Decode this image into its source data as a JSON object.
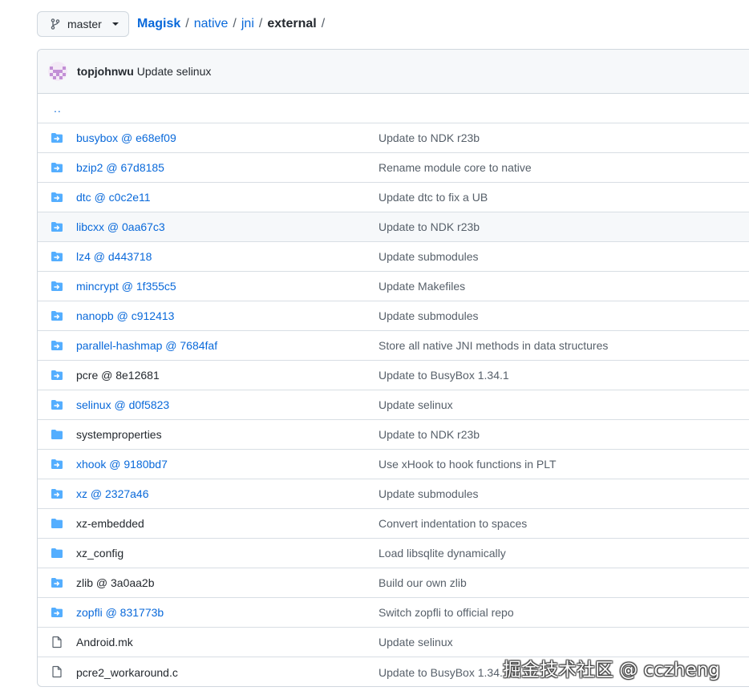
{
  "branch": {
    "label": "master"
  },
  "breadcrumb": {
    "repo": "Magisk",
    "seg1": "native",
    "seg2": "jni",
    "current": "external",
    "sep": "/"
  },
  "commit": {
    "author": "topjohnwu",
    "message": "Update selinux"
  },
  "parent_link": "..",
  "files": [
    {
      "name": "busybox @ e68ef09",
      "message": "Update to NDK r23b",
      "type": "submodule",
      "link": true
    },
    {
      "name": "bzip2 @ 67d8185",
      "message": "Rename module core to native",
      "type": "submodule",
      "link": true
    },
    {
      "name": "dtc @ c0c2e11",
      "message": "Update dtc to fix a UB",
      "type": "submodule",
      "link": true
    },
    {
      "name": "libcxx @ 0aa67c3",
      "message": "Update to NDK r23b",
      "type": "submodule",
      "link": true
    },
    {
      "name": "lz4 @ d443718",
      "message": "Update submodules",
      "type": "submodule",
      "link": true
    },
    {
      "name": "mincrypt @ 1f355c5",
      "message": "Update Makefiles",
      "type": "submodule",
      "link": true
    },
    {
      "name": "nanopb @ c912413",
      "message": "Update submodules",
      "type": "submodule",
      "link": true
    },
    {
      "name": "parallel-hashmap @ 7684faf",
      "message": "Store all native JNI methods in data structures",
      "type": "submodule",
      "link": true
    },
    {
      "name": "pcre @ 8e12681",
      "message": "Update to BusyBox 1.34.1",
      "type": "submodule",
      "link": false
    },
    {
      "name": "selinux @ d0f5823",
      "message": "Update selinux",
      "type": "submodule",
      "link": true
    },
    {
      "name": "systemproperties",
      "message": "Update to NDK r23b",
      "type": "folder",
      "link": false
    },
    {
      "name": "xhook @ 9180bd7",
      "message": "Use xHook to hook functions in PLT",
      "type": "submodule",
      "link": true
    },
    {
      "name": "xz @ 2327a46",
      "message": "Update submodules",
      "type": "submodule",
      "link": true
    },
    {
      "name": "xz-embedded",
      "message": "Convert indentation to spaces",
      "type": "folder",
      "link": false
    },
    {
      "name": "xz_config",
      "message": "Load libsqlite dynamically",
      "type": "folder",
      "link": false
    },
    {
      "name": "zlib @ 3a0aa2b",
      "message": "Build our own zlib",
      "type": "submodule",
      "link": false
    },
    {
      "name": "zopfli @ 831773b",
      "message": "Switch zopfli to official repo",
      "type": "submodule",
      "link": true
    },
    {
      "name": "Android.mk",
      "message": "Update selinux",
      "type": "file",
      "link": false
    },
    {
      "name": "pcre2_workaround.c",
      "message": "Update to BusyBox 1.34.1",
      "type": "file",
      "link": false
    }
  ],
  "hover_index": 3,
  "colors": {
    "link": "#0969da",
    "folder": "#54aeff",
    "muted": "#57606a"
  },
  "watermark": "掘金技术社区 @ cczheng"
}
